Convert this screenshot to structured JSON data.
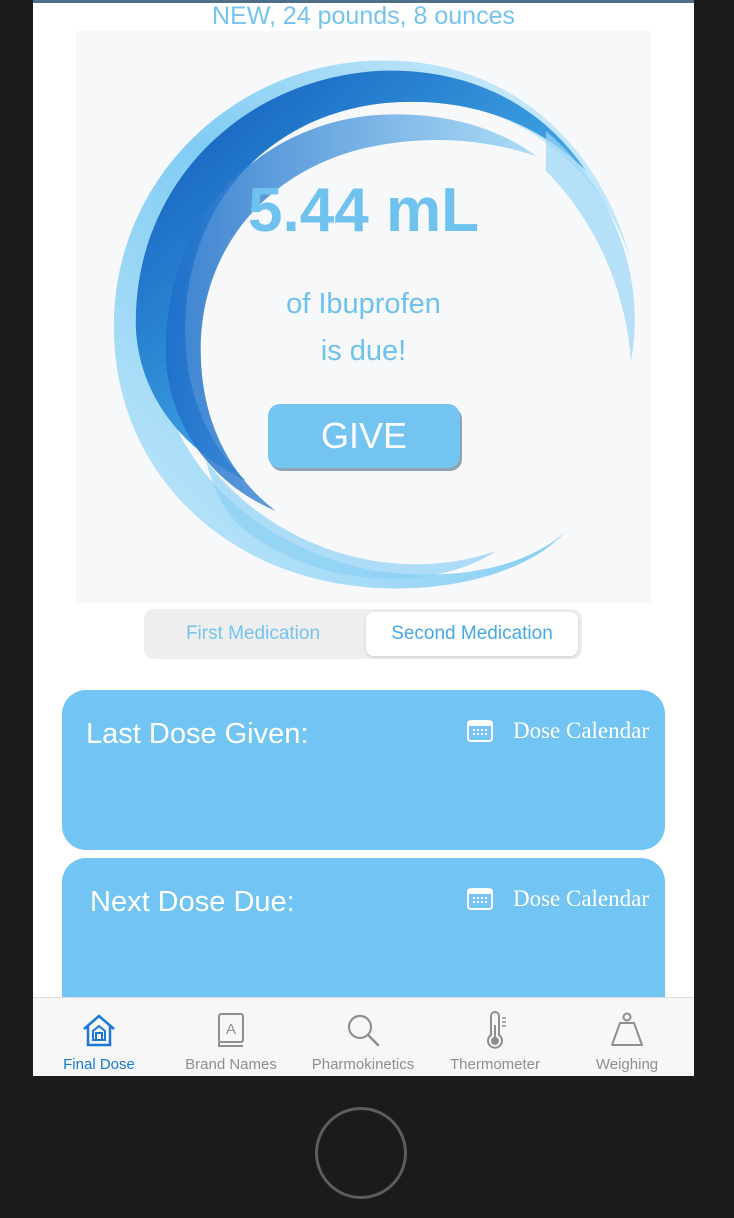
{
  "header": {
    "subtitle": "NEW, 24 pounds, 8 ounces"
  },
  "dose": {
    "amount": "5.44 mL",
    "medication_line": "of Ibuprofen",
    "status_line": "is due!",
    "give_label": "GIVE"
  },
  "medication_segment": {
    "options": [
      "First Medication",
      "Second Medication"
    ],
    "selected": "Second Medication"
  },
  "cards": [
    {
      "title": "Last Dose Given:",
      "link_label": "Dose Calendar",
      "icon": "calendar-icon"
    },
    {
      "title": "Next Dose Due:",
      "link_label": "Dose Calendar",
      "icon": "calendar-icon"
    }
  ],
  "tabbar": {
    "active": "Final Dose",
    "items": [
      {
        "label": "Final Dose",
        "icon": "home-icon"
      },
      {
        "label": "Brand Names",
        "icon": "book-icon"
      },
      {
        "label": "Pharmokinetics",
        "icon": "search-icon"
      },
      {
        "label": "Thermometer",
        "icon": "thermometer-icon"
      },
      {
        "label": "Weighing",
        "icon": "weight-icon"
      }
    ]
  },
  "colors": {
    "accent": "#72c4f3",
    "active_tab": "#1b78d6",
    "inactive_tab": "#8e8e93"
  }
}
